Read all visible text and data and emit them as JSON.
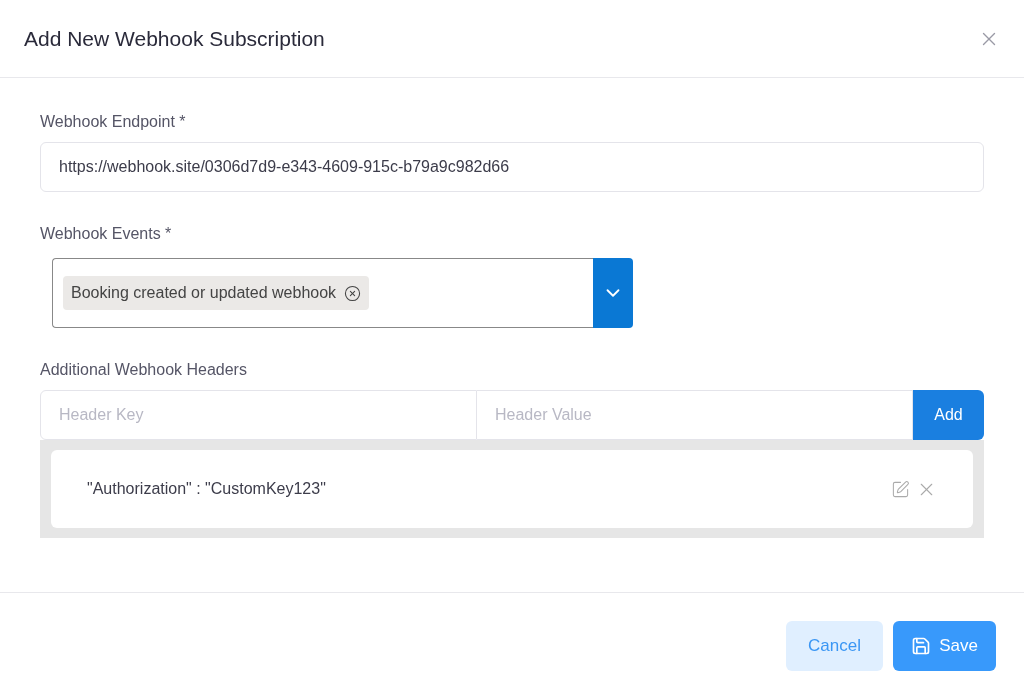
{
  "dialog": {
    "title": "Add New Webhook Subscription"
  },
  "endpoint": {
    "label": "Webhook Endpoint *",
    "value": "https://webhook.site/0306d7d9-e343-4609-915c-b79a9c982d66"
  },
  "events": {
    "label": "Webhook Events *",
    "tags": [
      "Booking created or updated webhook"
    ]
  },
  "headers": {
    "label": "Additional Webhook Headers",
    "key_placeholder": "Header Key",
    "value_placeholder": "Header Value",
    "add_button": "Add",
    "items": [
      "\"Authorization\" : \"CustomKey123\""
    ]
  },
  "buttons": {
    "cancel": "Cancel",
    "save": "Save"
  }
}
